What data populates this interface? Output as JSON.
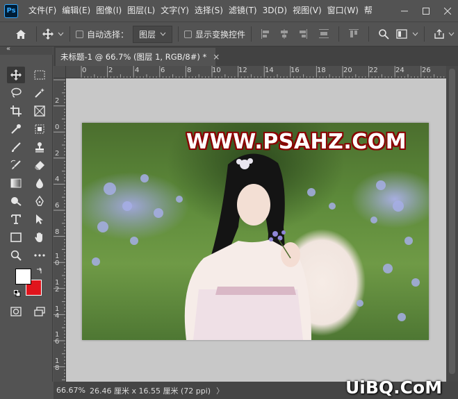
{
  "app": {
    "logo_text": "Ps"
  },
  "menu": [
    "文件(F)",
    "编辑(E)",
    "图像(I)",
    "图层(L)",
    "文字(Y)",
    "选择(S)",
    "滤镜(T)",
    "3D(D)",
    "视图(V)",
    "窗口(W)",
    "帮"
  ],
  "options": {
    "auto_select_label": "自动选择：",
    "target_value": "图层",
    "show_transform_label": "显示变换控件"
  },
  "document": {
    "tab_title": "未标题-1 @ 66.7% (图层 1, RGB/8#) *",
    "close_glyph": "×"
  },
  "ruler": {
    "h_labels": [
      "0",
      "2",
      "4",
      "6",
      "8",
      "10",
      "12",
      "14",
      "16",
      "18",
      "20",
      "22",
      "24",
      "26"
    ],
    "v_labels": [
      "2",
      "0",
      "2",
      "4",
      "6",
      "8",
      "1\n0",
      "1\n2",
      "1\n4",
      "1\n6",
      "1\n8"
    ]
  },
  "image": {
    "watermark": "WWW.PSAHZ.COM"
  },
  "status": {
    "zoom": "66.67%",
    "doc_info": "26.46 厘米 x 16.55 厘米 (72 ppi)",
    "arrow": "〉"
  },
  "site_watermark": "UiBQ.CoM",
  "colors": {
    "foreground": "#ffffff",
    "background": "#e0141c",
    "accent": "#31a8ff"
  }
}
